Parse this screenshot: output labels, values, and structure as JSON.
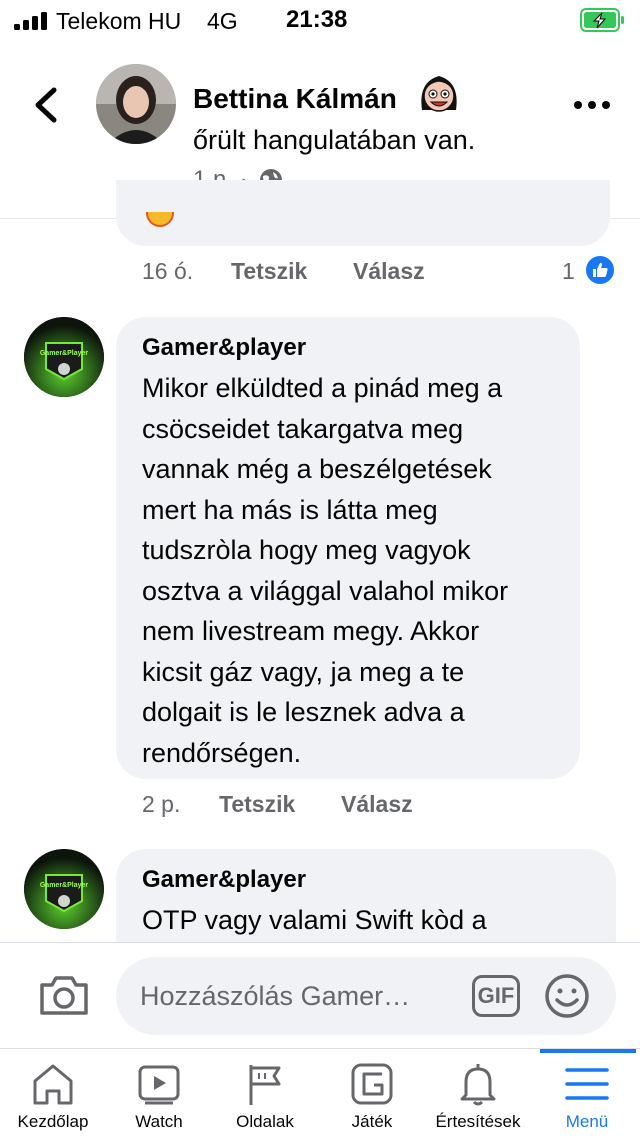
{
  "status_bar": {
    "carrier": "Telekom HU",
    "network": "4G",
    "time": "21:38",
    "battery_state": "charging",
    "battery_color": "#34c759"
  },
  "post_header": {
    "author": "Bettina Kálmán",
    "mood_text": "őrült hangulatában van.",
    "time_ago": "1 n. ·",
    "audience_icon": "globe-icon"
  },
  "previous_comment": {
    "time": "16 ó.",
    "like_label": "Tetszik",
    "reply_label": "Válasz",
    "reaction_count": "1",
    "reaction_icon": "thumbs-up-icon",
    "reaction_color": "#1877f2"
  },
  "comments": [
    {
      "author": "Gamer&player",
      "text": "Mikor elküldted a pinád meg a\ncsöcseidet takargatva meg\nvannak még a beszélgetések\nmert ha más is látta meg\ntudszròla hogy meg vagyok\nosztva a világgal valahol mikor\nnem livestream megy. Akkor\nkicsit gáz vagy, ja meg a te\ndolgait is le lesznek adva a\nrendőrségen.",
      "time": "2 p.",
      "like_label": "Tetszik",
      "reply_label": "Válasz"
    },
    {
      "author": "Gamer&player",
      "text": "OTP vagy valami Swift kòd a"
    }
  ],
  "composer": {
    "placeholder": "Hozzászólás Gamer…",
    "gif_label": "GIF"
  },
  "tabbar": {
    "active_color": "#1877f2",
    "items": [
      {
        "label": "Kezdőlap",
        "icon": "home-icon"
      },
      {
        "label": "Watch",
        "icon": "video-icon"
      },
      {
        "label": "Oldalak",
        "icon": "flag-icon"
      },
      {
        "label": "Játék",
        "icon": "gaming-icon"
      },
      {
        "label": "Értesítések",
        "icon": "bell-icon"
      },
      {
        "label": "Menü",
        "icon": "menu-icon"
      }
    ]
  }
}
